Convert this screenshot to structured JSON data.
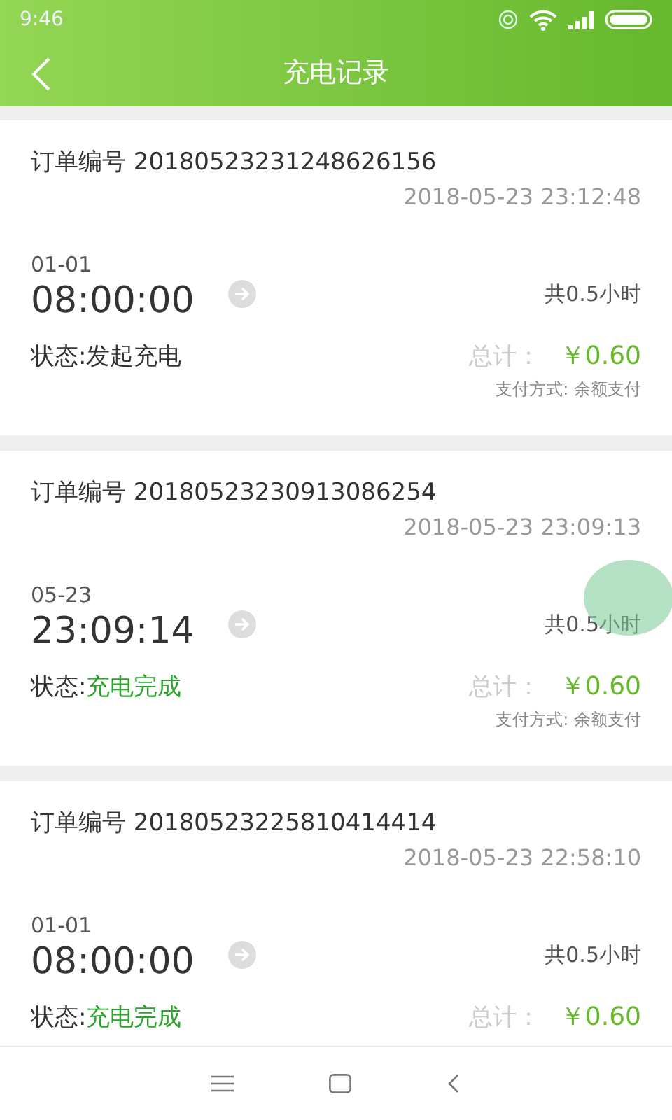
{
  "status_bar": {
    "time": "9:46"
  },
  "header": {
    "title": "充电记录"
  },
  "records": [
    {
      "order_label": "订单编号",
      "order_no": "20180523231248626156",
      "created": "2018-05-23 23:12:48",
      "start_date": "01-01",
      "start_time": "08:00:00",
      "duration": "共0.5小时",
      "status_label": "状态:",
      "status": "发起充电",
      "completed": false,
      "total_label": "总计：",
      "amount": "￥0.60",
      "payment": "支付方式: 余额支付"
    },
    {
      "order_label": "订单编号",
      "order_no": "20180523230913086254",
      "created": "2018-05-23 23:09:13",
      "start_date": "05-23",
      "start_time": "23:09:14",
      "duration": "共0.5小时",
      "status_label": "状态:",
      "status": "充电完成",
      "completed": true,
      "total_label": "总计：",
      "amount": "￥0.60",
      "payment": "支付方式: 余额支付"
    },
    {
      "order_label": "订单编号",
      "order_no": "20180523225810414414",
      "created": "2018-05-23 22:58:10",
      "start_date": "01-01",
      "start_time": "08:00:00",
      "duration": "共0.5小时",
      "status_label": "状态:",
      "status": "充电完成",
      "completed": true,
      "total_label": "总计：",
      "amount": "￥0.60"
    }
  ]
}
